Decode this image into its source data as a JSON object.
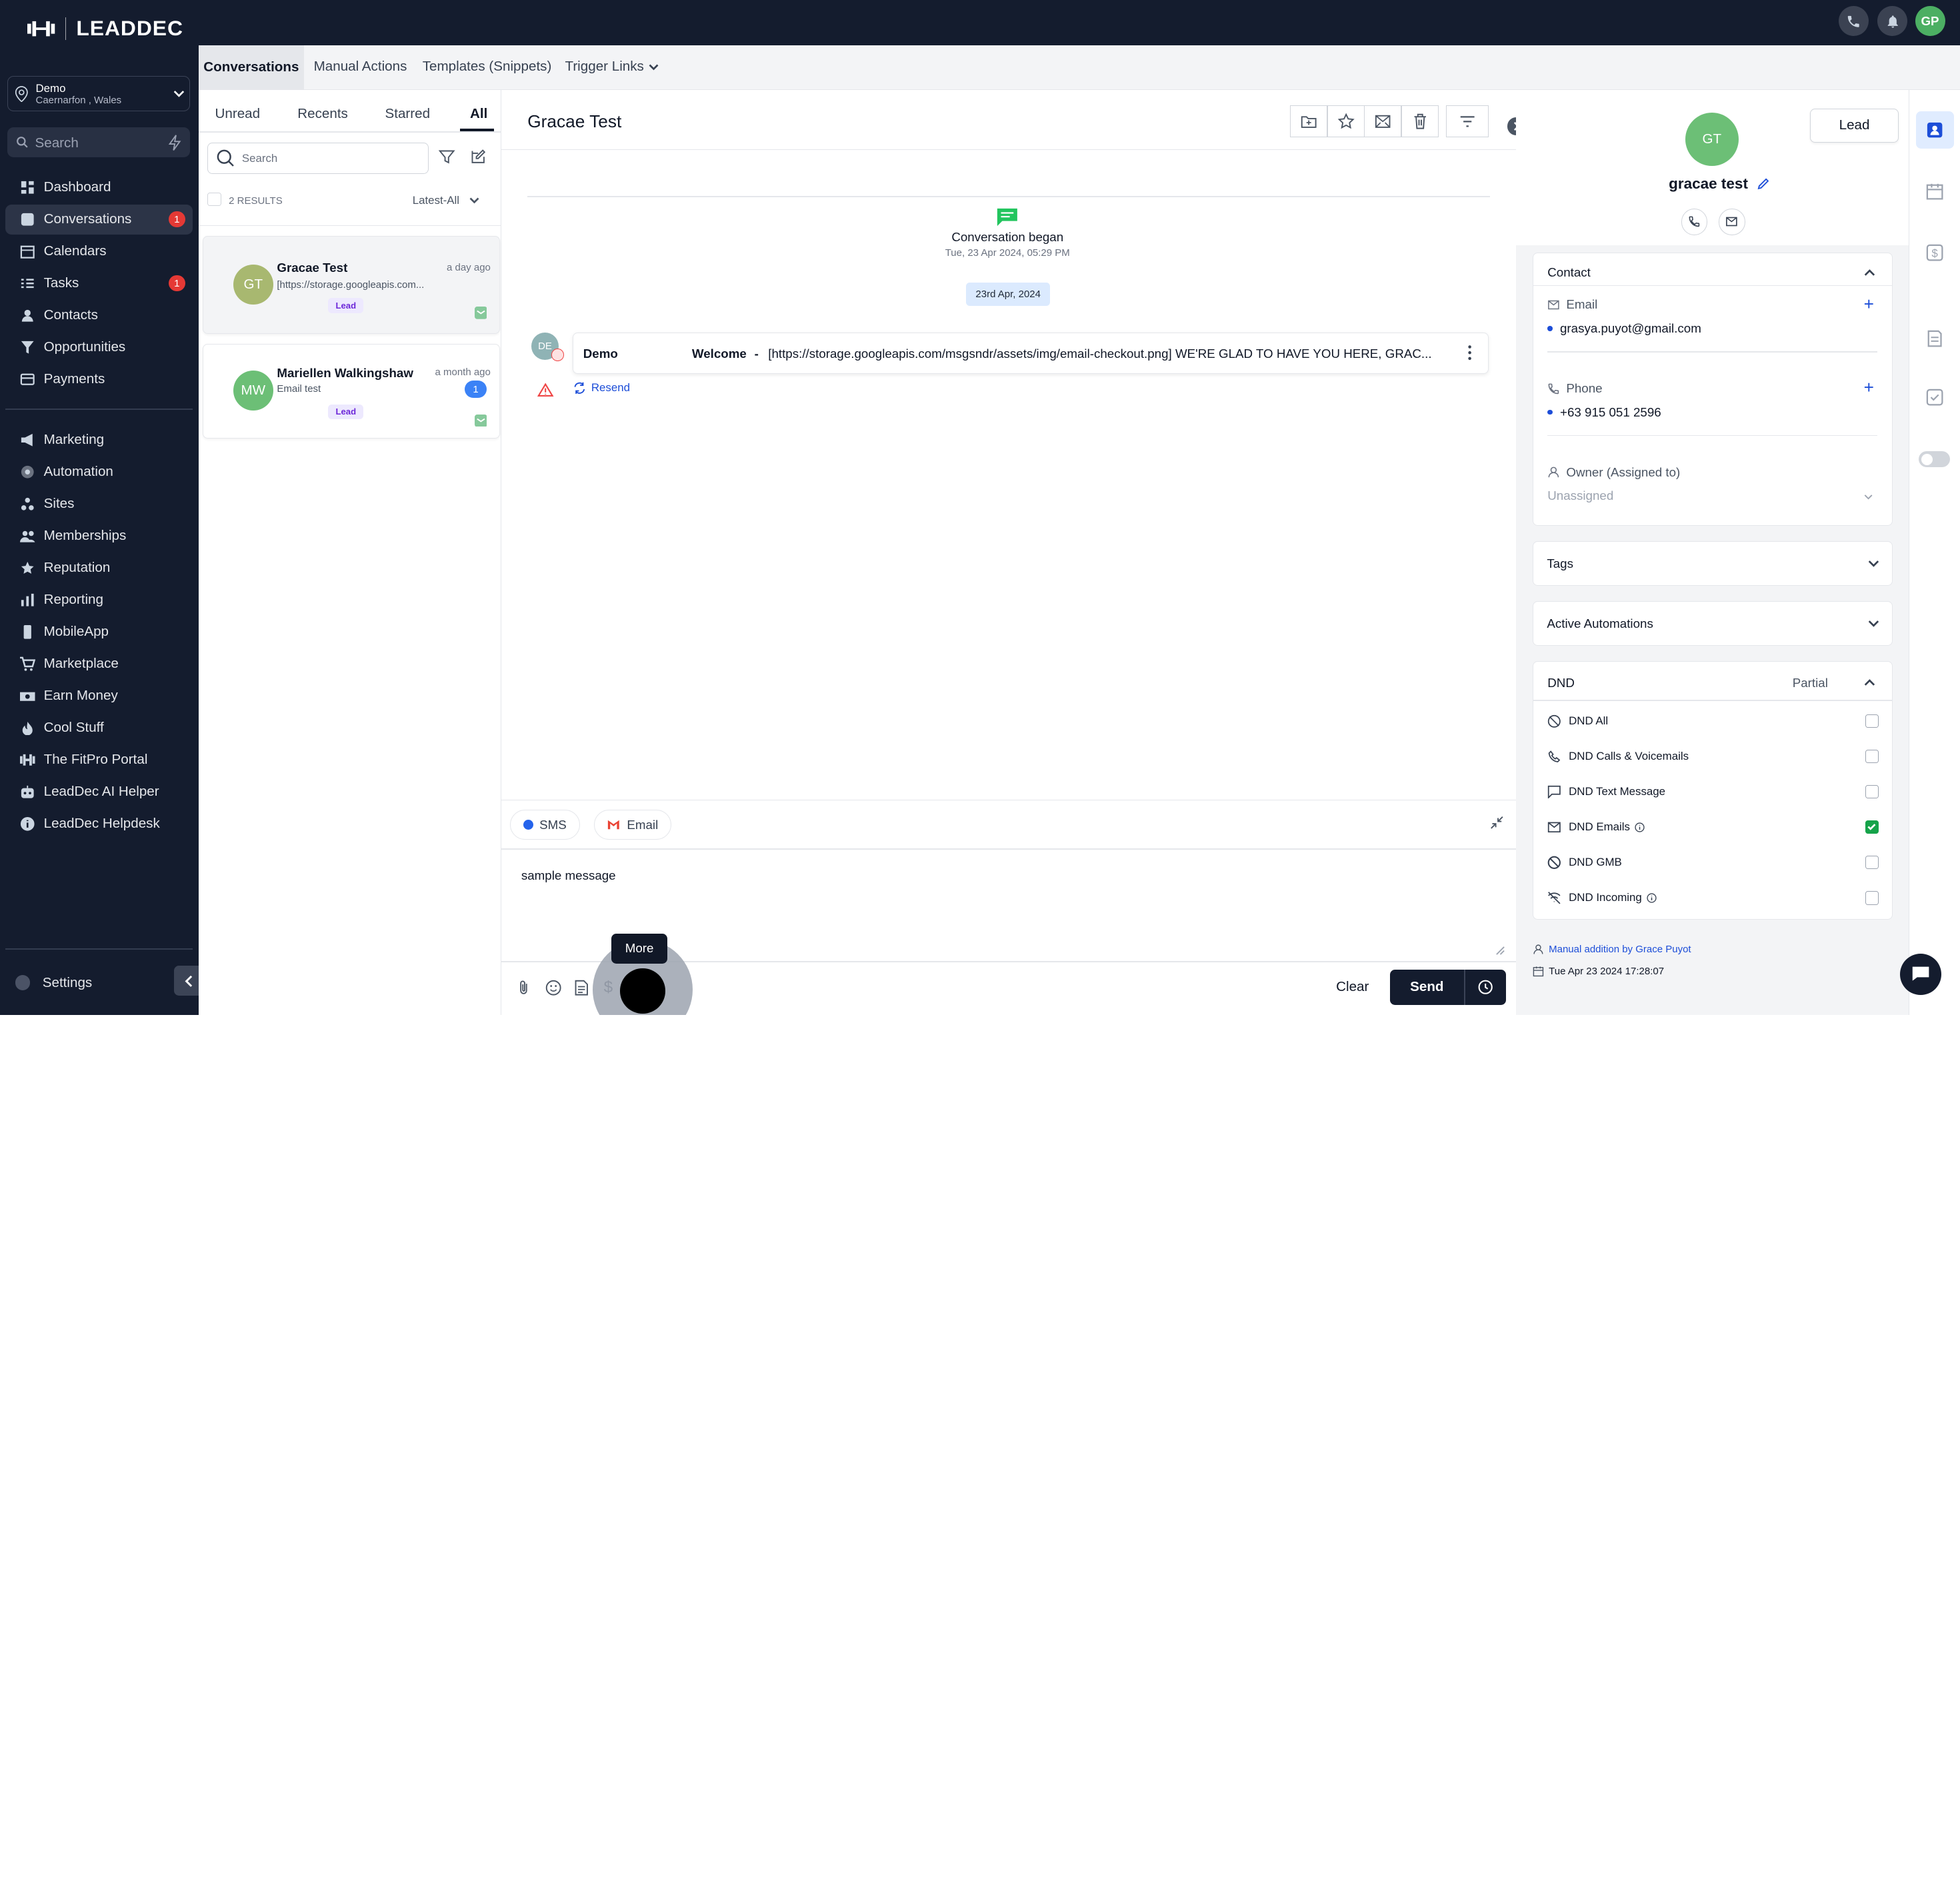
{
  "app": {
    "logo_text": "LEADDEC",
    "user_initials": "GP"
  },
  "account": {
    "name": "Demo",
    "location": "Caernarfon , Wales"
  },
  "sidebar": {
    "search_placeholder": "Search",
    "items": [
      {
        "label": "Dashboard",
        "icon": "dashboard-icon"
      },
      {
        "label": "Conversations",
        "icon": "chat-icon",
        "badge": "1",
        "active": true
      },
      {
        "label": "Calendars",
        "icon": "calendar-icon"
      },
      {
        "label": "Tasks",
        "icon": "checklist-icon",
        "badge": "1"
      },
      {
        "label": "Contacts",
        "icon": "person-icon"
      },
      {
        "label": "Opportunities",
        "icon": "funnel-icon"
      },
      {
        "label": "Payments",
        "icon": "card-icon"
      }
    ],
    "items2": [
      {
        "label": "Marketing",
        "icon": "megaphone-icon"
      },
      {
        "label": "Automation",
        "icon": "gear-icon"
      },
      {
        "label": "Sites",
        "icon": "sites-icon"
      },
      {
        "label": "Memberships",
        "icon": "members-icon"
      },
      {
        "label": "Reputation",
        "icon": "star-icon"
      },
      {
        "label": "Reporting",
        "icon": "chart-icon"
      },
      {
        "label": "MobileApp",
        "icon": "phone-icon"
      },
      {
        "label": "Marketplace",
        "icon": "cart-icon"
      },
      {
        "label": "Earn Money",
        "icon": "money-icon"
      },
      {
        "label": "Cool Stuff",
        "icon": "flame-icon"
      },
      {
        "label": "The FitPro Portal",
        "icon": "dumbbell-icon"
      },
      {
        "label": "LeadDec AI Helper",
        "icon": "robot-icon"
      },
      {
        "label": "LeadDec Helpdesk",
        "icon": "info-icon"
      }
    ],
    "settings": "Settings"
  },
  "tabs": {
    "conversations": "Conversations",
    "manual_actions": "Manual Actions",
    "templates": "Templates (Snippets)",
    "trigger_links": "Trigger Links"
  },
  "filters": {
    "unread": "Unread",
    "recents": "Recents",
    "starred": "Starred",
    "all": "All"
  },
  "list": {
    "search_placeholder": "Search",
    "results": "2 RESULTS",
    "sort": "Latest-All",
    "conversations": [
      {
        "initials": "GT",
        "name": "Gracae Test",
        "time": "a day ago",
        "preview": "[https://storage.googleapis.com...",
        "tag": "Lead",
        "avatar_color": "#a8b870"
      },
      {
        "initials": "MW",
        "name": "Mariellen Walkingshaw",
        "time": "a month ago",
        "preview": "Email test",
        "tag": "Lead",
        "unread": "1",
        "avatar_color": "#6cbf76"
      }
    ]
  },
  "thread": {
    "title": "Gracae Test",
    "began_title": "Conversation began",
    "began_date": "Tue, 23 Apr 2024, 05:29 PM",
    "date_chip": "23rd Apr, 2024",
    "message": {
      "avatar": "DE",
      "sender": "Demo",
      "subject": "Welcome",
      "separator": "-",
      "body": "[https://storage.googleapis.com/msgsndr/assets/img/email-checkout.png] WE'RE GLAD TO HAVE YOU HERE, GRAC...",
      "resend": "Resend"
    }
  },
  "composer": {
    "sms": "SMS",
    "email": "Email",
    "text": "sample message",
    "tooltip": "More",
    "clear": "Clear",
    "send": "Send"
  },
  "contact": {
    "initials": "GT",
    "name": "gracae test",
    "type_button": "Lead",
    "section_contact": "Contact",
    "email_label": "Email",
    "email": "grasya.puyot@gmail.com",
    "phone_label": "Phone",
    "phone": "+63 915 051 2596",
    "owner_label": "Owner (Assigned to)",
    "owner_value": "Unassigned",
    "tags": "Tags",
    "automations": "Active Automations",
    "dnd": "DND",
    "dnd_status": "Partial",
    "dnd_items": [
      {
        "label": "DND All",
        "checked": false
      },
      {
        "label": "DND Calls & Voicemails",
        "checked": false
      },
      {
        "label": "DND Text Message",
        "checked": false
      },
      {
        "label": "DND Emails",
        "checked": true
      },
      {
        "label": "DND GMB",
        "checked": false
      },
      {
        "label": "DND Incoming",
        "checked": false
      }
    ],
    "footer_source": "Manual addition by Grace Puyot",
    "footer_date": "Tue Apr 23 2024 17:28:07"
  },
  "colors": {
    "brand_dark": "#141c2e",
    "accent_blue": "#1d4ed8",
    "success_green": "#16a34a",
    "badge_red": "#e53935"
  }
}
